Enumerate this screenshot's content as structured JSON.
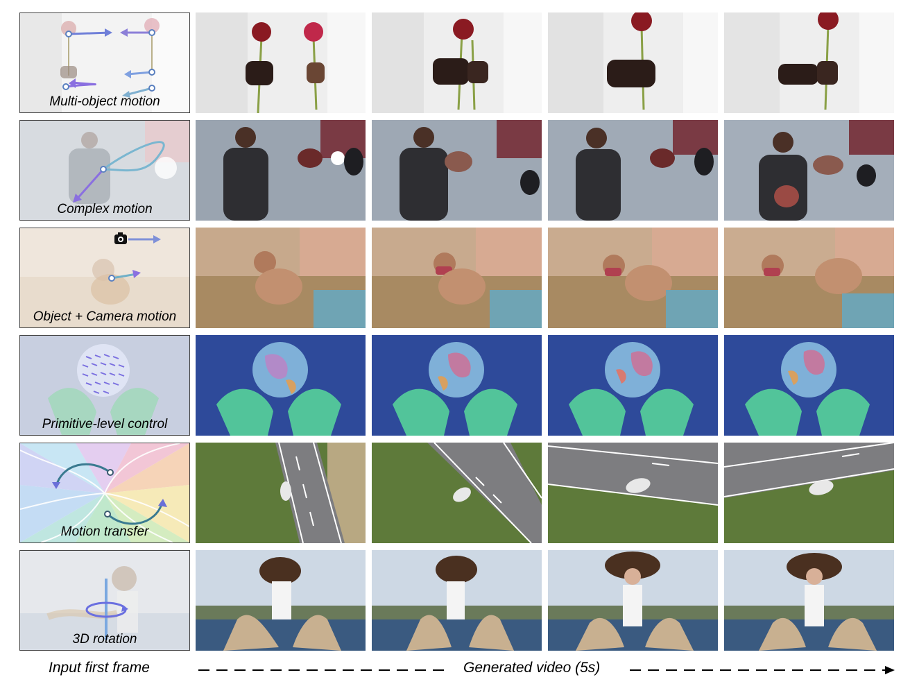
{
  "rows": [
    {
      "label": "Multi-object motion"
    },
    {
      "label": "Complex motion"
    },
    {
      "label": "Object + Camera motion"
    },
    {
      "label": "Primitive-level control"
    },
    {
      "label": "Motion transfer"
    },
    {
      "label": "3D rotation"
    }
  ],
  "captions": {
    "input": "Input first frame",
    "generated": "Generated video  (5s)"
  },
  "icons": {
    "camera": "camera-icon",
    "arrow": "right-arrow-icon"
  }
}
